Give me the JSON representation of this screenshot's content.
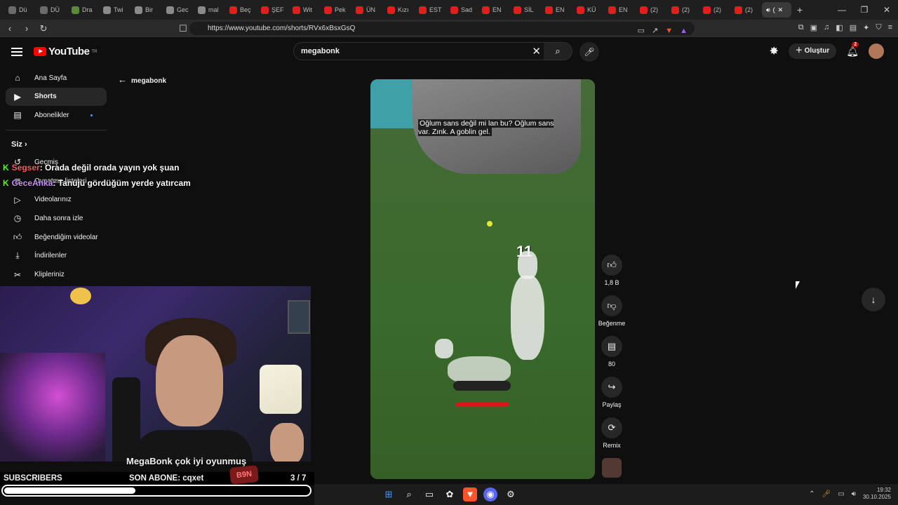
{
  "browser": {
    "tabs": [
      {
        "label": "Dü",
        "color": "#6b6b6b"
      },
      {
        "label": "DÜ",
        "color": "#6b6b6b"
      },
      {
        "label": "Dra",
        "color": "#5a8a3a"
      },
      {
        "label": "Twi",
        "color": "#8a8a8a"
      },
      {
        "label": "Bir",
        "color": "#8a8a8a"
      },
      {
        "label": "Gec",
        "color": "#8a8a8a"
      },
      {
        "label": "mal",
        "color": "#8a8a8a"
      },
      {
        "label": "Beç",
        "color": "#e01e1e"
      },
      {
        "label": "ŞEF",
        "color": "#e01e1e"
      },
      {
        "label": "Wit",
        "color": "#e01e1e"
      },
      {
        "label": "Pek",
        "color": "#e01e1e"
      },
      {
        "label": "ÜN",
        "color": "#e01e1e"
      },
      {
        "label": "Kızı",
        "color": "#e01e1e"
      },
      {
        "label": "EST",
        "color": "#e01e1e"
      },
      {
        "label": "Sad",
        "color": "#e01e1e"
      },
      {
        "label": "EN",
        "color": "#e01e1e"
      },
      {
        "label": "SİL",
        "color": "#e01e1e"
      },
      {
        "label": "EN",
        "color": "#e01e1e"
      },
      {
        "label": "KÜ",
        "color": "#e01e1e"
      },
      {
        "label": "EN",
        "color": "#e01e1e"
      },
      {
        "label": "(2)",
        "color": "#e01e1e"
      },
      {
        "label": "(2)",
        "color": "#e01e1e"
      },
      {
        "label": "(2)",
        "color": "#e01e1e"
      },
      {
        "label": "(2)",
        "color": "#e01e1e"
      }
    ],
    "active_tab": "(",
    "url": "https://www.youtube.com/shorts/RVx6xBsxGsQ"
  },
  "youtube": {
    "logo_text": "YouTube",
    "logo_region": "TR",
    "search_value": "megabonk",
    "create_label": "Oluştur",
    "notification_count": "2",
    "back_label": "megabonk",
    "sidebar": {
      "items": [
        {
          "label": "Ana Sayfa",
          "icon": "home-icon"
        },
        {
          "label": "Shorts",
          "icon": "shorts-icon"
        },
        {
          "label": "Abonelikler",
          "icon": "subscriptions-icon"
        }
      ],
      "you_heading": "Siz",
      "you_items": [
        {
          "label": "Geçmiş",
          "icon": "history-icon"
        },
        {
          "label": "Oynatma listeleri",
          "icon": "playlist-icon"
        },
        {
          "label": "Videolarınız",
          "icon": "your-videos-icon"
        },
        {
          "label": "Daha sonra izle",
          "icon": "watch-later-icon"
        },
        {
          "label": "Beğendiğim videolar",
          "icon": "liked-icon"
        },
        {
          "label": "İndirilenler",
          "icon": "downloads-icon"
        },
        {
          "label": "Klipleriniz",
          "icon": "clips-icon"
        }
      ]
    },
    "short": {
      "caption": "Oğlum sans değil mi lan bu? Oğlum sans var. Zınk. A goblin gel.",
      "damage_number": "11"
    },
    "actions": {
      "like_count": "1,8 B",
      "dislike_label": "Beğenme",
      "comment_count": "80",
      "share_label": "Paylaş",
      "remix_label": "Remix"
    }
  },
  "stream_overlay": {
    "chat": [
      {
        "user": "Segser",
        "message": ": Orada değil orada yayın yok şuan"
      },
      {
        "user": "GeceAnka",
        "message": ": Tanuju gördüğüm yerde yatırcam"
      }
    ],
    "ticker_text": "MegaBonk çok iyi oyunmuş",
    "subscribers_label": "SUBSCRIBERS",
    "last_sub_label": "SON ABONE: cqxet",
    "sub_goal": "3  / 7",
    "logo_text": "B9N",
    "sub_goal_progress": 0.43
  },
  "taskbar": {
    "time": "19:32",
    "date": "30.10.2025"
  }
}
